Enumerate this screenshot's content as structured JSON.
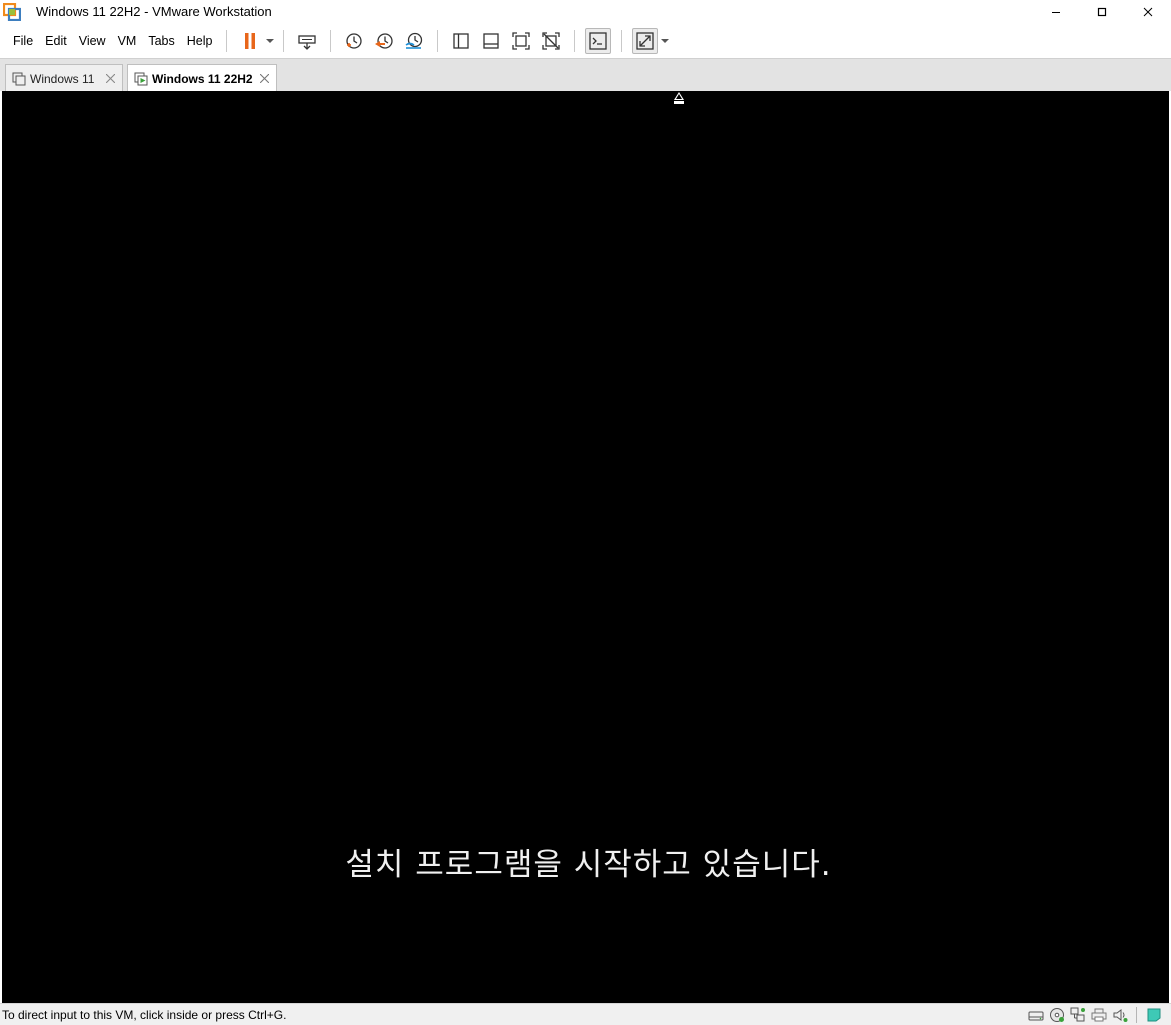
{
  "window": {
    "title": "Windows 11 22H2 - VMware Workstation",
    "controls": [
      "minimize",
      "maximize",
      "close"
    ]
  },
  "menu": {
    "items": [
      "File",
      "Edit",
      "View",
      "VM",
      "Tabs",
      "Help"
    ]
  },
  "toolbar": {
    "icons": [
      "pause-icon",
      "send-ctrl-alt-del-icon",
      "snapshot-icon",
      "revert-snapshot-icon",
      "snapshot-manager-icon",
      "library-view-icon",
      "thumbnail-bar-icon",
      "full-screen-icon",
      "unity-icon",
      "console-icon",
      "stretch-guest-icon"
    ],
    "accent_color": "#e8661a"
  },
  "tabs": [
    {
      "label": "Windows 11",
      "active": false
    },
    {
      "label": "Windows 11 22H2",
      "active": true
    }
  ],
  "vm": {
    "message": "설치 프로그램을 시작하고 있습니다.",
    "background": "#000000"
  },
  "statusbar": {
    "text": "To direct input to this VM, click inside or press Ctrl+G.",
    "icons": [
      "hard-disk-icon",
      "cd-dvd-icon",
      "network-adapter-icon",
      "printer-icon",
      "sound-card-icon",
      "message-log-icon"
    ]
  }
}
